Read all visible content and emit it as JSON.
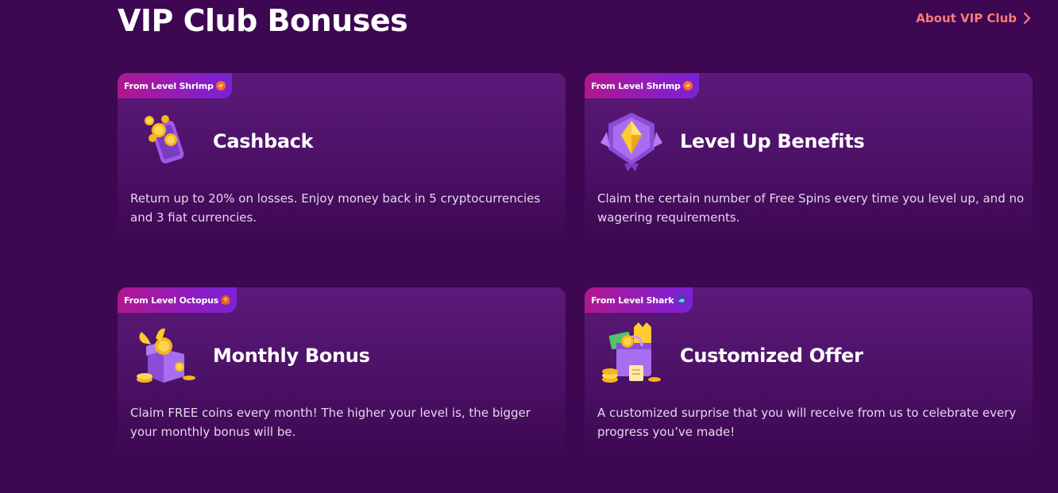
{
  "header": {
    "title": "VIP Club Bonuses",
    "about_link": "About VIP Club"
  },
  "cards": [
    {
      "badge": "From Level Shrimp",
      "badge_icon": "shrimp-icon",
      "title": "Cashback",
      "description": "Return up to 20% on losses. Enjoy money back in 5 cryptocurrencies and 3 fiat currencies.",
      "icon": "phone-coins-icon"
    },
    {
      "badge": "From Level Shrimp",
      "badge_icon": "shrimp-icon",
      "title": "Level Up Benefits",
      "description": "Claim the certain number of Free Spins every time you level up, and no wagering requirements.",
      "icon": "diamond-shield-icon"
    },
    {
      "badge": "From Level Octopus",
      "badge_icon": "octopus-icon",
      "title": "Monthly Bonus",
      "description": "Claim FREE coins every month! The higher your level is, the bigger your monthly bonus will be.",
      "icon": "gift-coins-icon"
    },
    {
      "badge": "From Level Shark",
      "badge_icon": "shark-icon",
      "title": "Customized Offer",
      "description": "A customized surprise that you will receive from us to celebrate every progress you’ve made!",
      "icon": "shopping-bag-icon"
    }
  ],
  "colors": {
    "background": "#3d0751",
    "card": "#5c1a7a",
    "accent_link": "#ff7a7a",
    "badge_start": "#b0178e",
    "badge_end": "#7a22d6"
  }
}
